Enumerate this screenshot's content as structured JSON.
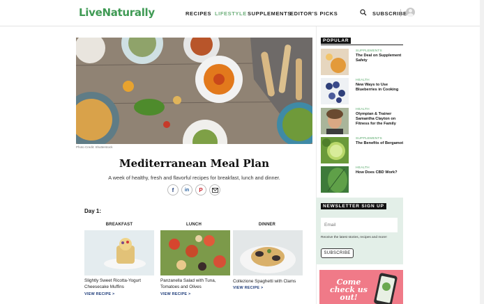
{
  "header": {
    "logo": "LiveNaturally",
    "nav": [
      {
        "label": "RECIPES",
        "active": false
      },
      {
        "label": "LIFESTYLE",
        "active": true
      },
      {
        "label": "SUPPLEMENTS",
        "active": false
      },
      {
        "label": "EDITOR'S PICKS",
        "active": false
      }
    ],
    "subscribe": "SUBSCRIBE"
  },
  "article": {
    "photo_credit": "Photo Credit: Shutterstock",
    "title": "Mediterranean Meal Plan",
    "subtitle": "A week of healthy, fresh and flavorful recipes for breakfast, lunch and dinner.",
    "share_icons": [
      "facebook-icon",
      "linkedin-icon",
      "pinterest-icon",
      "email-icon"
    ],
    "day_label": "Day 1:",
    "view_label": "VIEW RECIPE >",
    "meals": [
      {
        "heading": "BREAKFAST",
        "name": "Slightly Sweet Ricotta-Yogurt Cheesecake Muffins"
      },
      {
        "heading": "LUNCH",
        "name": "Panzanella Salad with Tuna, Tomatoes and Olives"
      },
      {
        "heading": "DINNER",
        "name": "Collezione Spaghetti with Clams"
      }
    ]
  },
  "sidebar": {
    "popular_label": "POPULAR",
    "popular": [
      {
        "category": "SUPPLEMENTS",
        "title": "The Deal on Supplement Safety"
      },
      {
        "category": "HEALTH",
        "title": "New Ways to Use Blueberries in Cooking"
      },
      {
        "category": "HEALTH",
        "title": "Olympian & Trainer Samantha Clayton on Fitness for the Family"
      },
      {
        "category": "SUPPLEMENTS",
        "title": "The Benefits of Bergamot"
      },
      {
        "category": "HEALTH",
        "title": "How Does CBD Work?"
      }
    ],
    "newsletter": {
      "label": "NEWSLETTER SIGN UP",
      "placeholder": "Email",
      "note": "Receive the latest stories, recipes and more!",
      "button": "SUBSCRIBE"
    },
    "promo_text": "Come check us out!"
  },
  "colors": {
    "brand_green": "#3f9a54",
    "active_nav": "#6fb07c",
    "link_blue": "#1f3d7a",
    "newsletter_bg": "#e3efe8",
    "promo_pink": "#f07a88"
  }
}
